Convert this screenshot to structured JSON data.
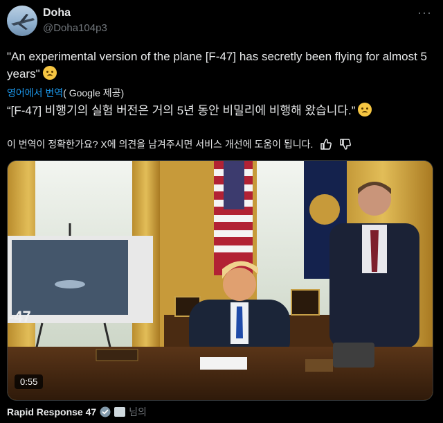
{
  "author": {
    "display_name": "Doha",
    "handle": "@Doha104p3"
  },
  "more_label": "···",
  "tweet": {
    "text": "\"An experimental version of the plane [F-47] has secretly been flying for almost 5 years\""
  },
  "translation": {
    "link_label": "영어에서 번역",
    "provider_label": "( Google 제공)",
    "text": "“[F-47] 비행기의 실험 버전은 거의 5년 동안 비밀리에 비행해 왔습니다.”",
    "feedback_prompt": "이 번역이 정확한가요? X에 의견을 남겨주시면 서비스 개선에 도움이 됩니다."
  },
  "media": {
    "duration": "0:55",
    "easel_label": "-47"
  },
  "source": {
    "name": "Rapid Response 47",
    "suffix": "님의"
  },
  "colors": {
    "background": "#000000",
    "link": "#1d9bf0",
    "muted": "#71767b",
    "verified": "#829aab"
  },
  "icons": {
    "more": "more-dots-icon",
    "thumbs_up": "thumbs-up-icon",
    "thumbs_down": "thumbs-down-icon",
    "verified": "verified-badge-icon",
    "government": "government-building-icon"
  }
}
